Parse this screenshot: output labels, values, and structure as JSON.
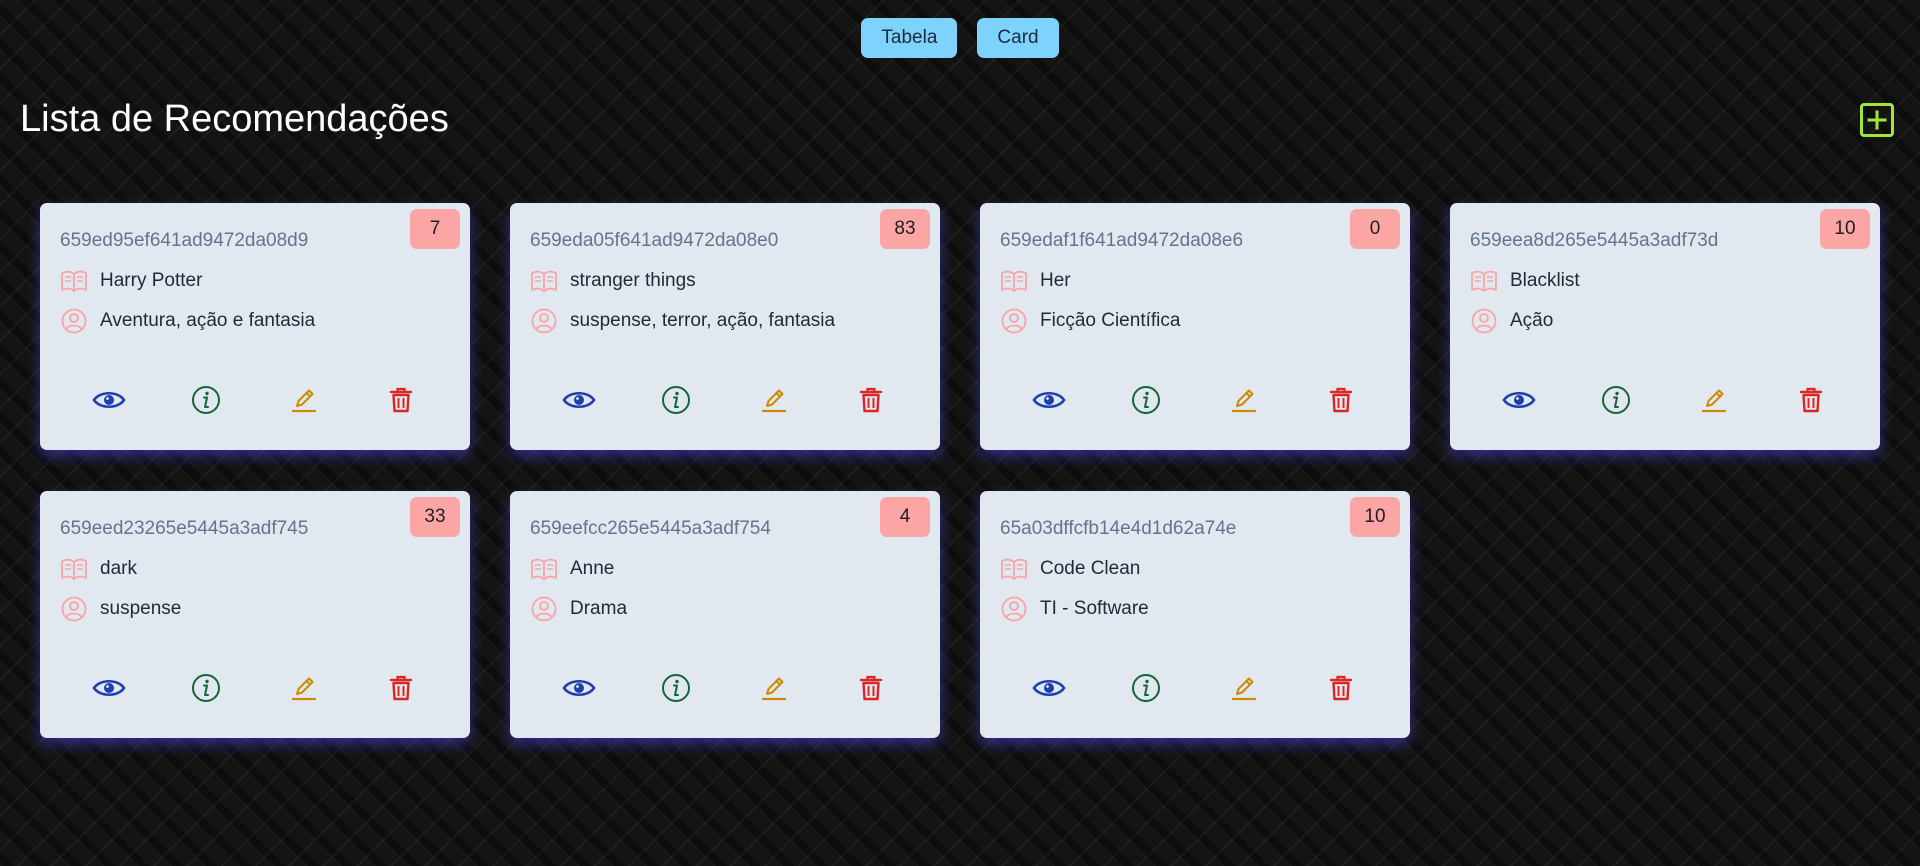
{
  "toolbar": {
    "table_label": "Tabela",
    "card_label": "Card"
  },
  "page": {
    "title": "Lista de Recomendações"
  },
  "colors": {
    "toggle_bg": "#7dd3fc",
    "add_accent": "#a3e635",
    "badge_bg": "#fca5a5",
    "view_icon": "#1e40af",
    "info_icon": "#166534",
    "edit_icon": "#ca8a04",
    "delete_icon": "#dc2626",
    "row_icon": "#f8a5a5"
  },
  "icons": {
    "add": "plus-square-icon",
    "title_row": "book-icon",
    "genre_row": "user-circle-icon",
    "view": "eye-icon",
    "info": "info-icon",
    "edit": "pencil-icon",
    "delete": "trash-icon"
  },
  "cards": [
    {
      "id": "659ed95ef641ad9472da08d9",
      "count": "7",
      "title": "Harry Potter",
      "genre": "Aventura, ação e fantasia"
    },
    {
      "id": "659eda05f641ad9472da08e0",
      "count": "83",
      "title": "stranger things",
      "genre": "suspense, terror, ação, fantasia"
    },
    {
      "id": "659edaf1f641ad9472da08e6",
      "count": "0",
      "title": "Her",
      "genre": "Ficção Científica"
    },
    {
      "id": "659eea8d265e5445a3adf73d",
      "count": "10",
      "title": "Blacklist",
      "genre": "Ação"
    },
    {
      "id": "659eed23265e5445a3adf745",
      "count": "33",
      "title": "dark",
      "genre": "suspense"
    },
    {
      "id": "659eefcc265e5445a3adf754",
      "count": "4",
      "title": "Anne",
      "genre": "Drama"
    },
    {
      "id": "65a03dffcfb14e4d1d62a74e",
      "count": "10",
      "title": "Code Clean",
      "genre": "TI - Software"
    }
  ]
}
